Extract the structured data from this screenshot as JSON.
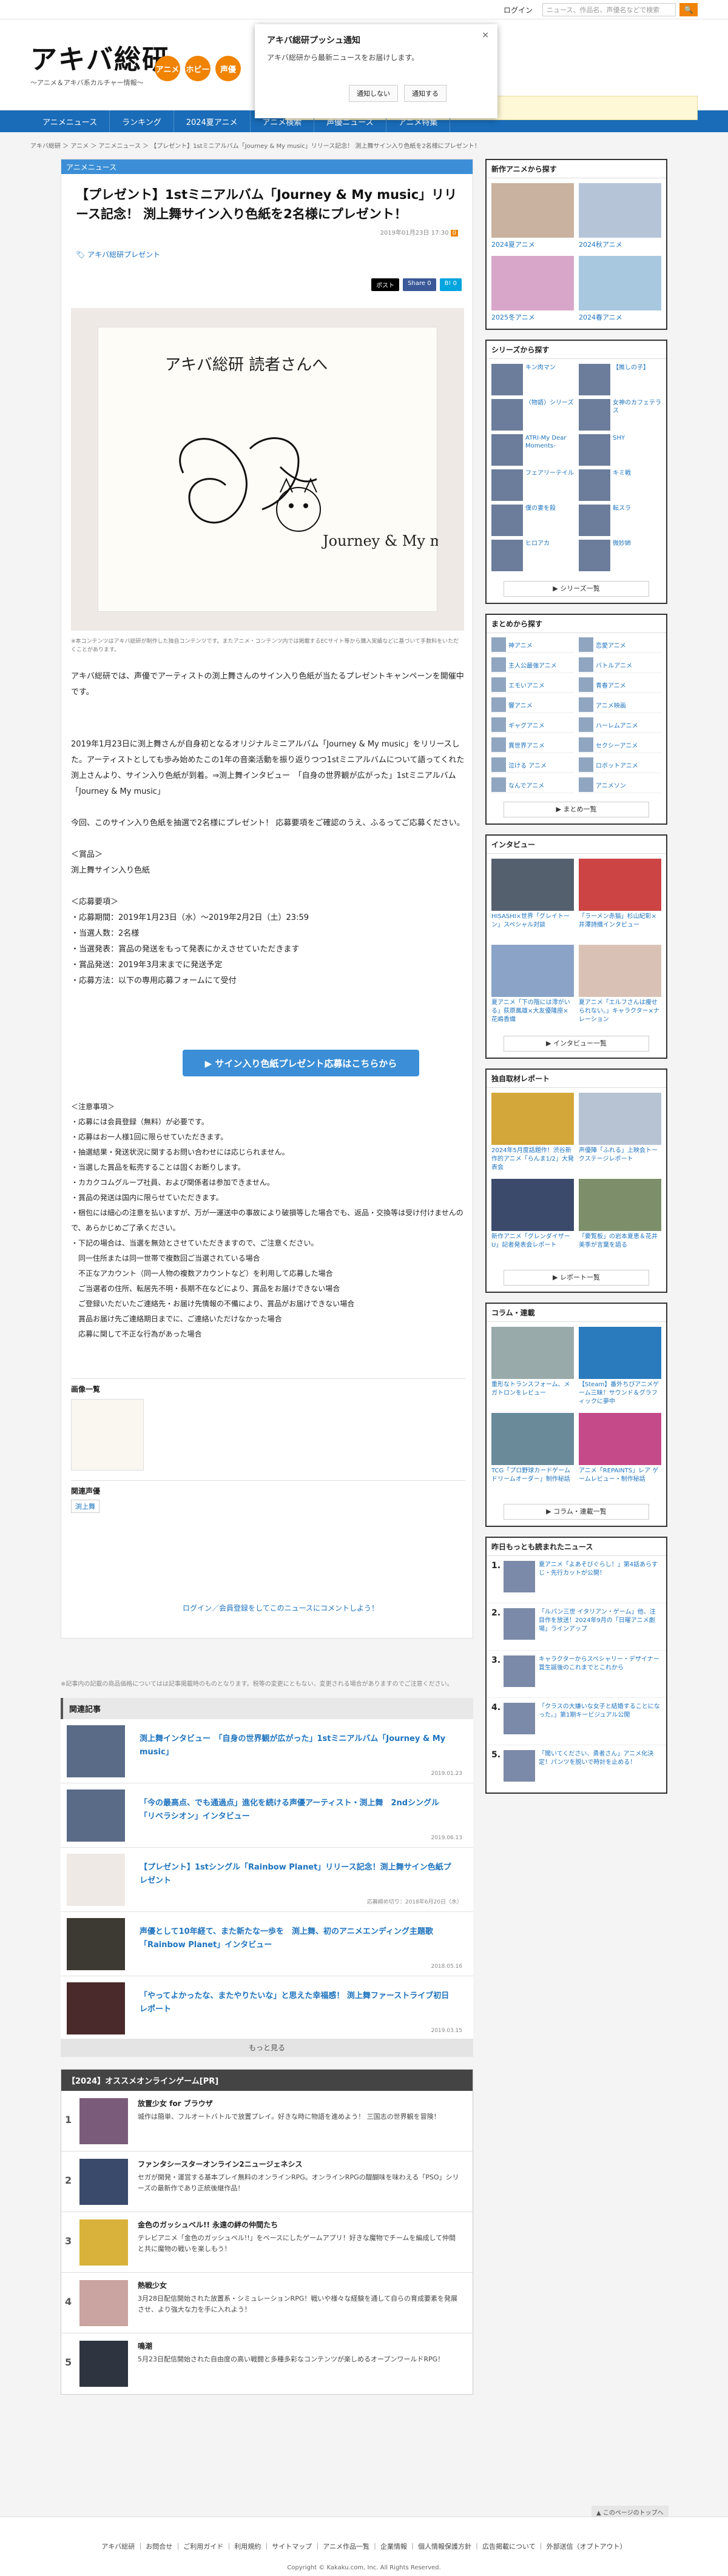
{
  "topbar": {
    "login": "ログイン",
    "search_placeholder": "ニュース、作品名、声優名などで検索",
    "search_btn": "🔍"
  },
  "header": {
    "logo": "アキバ総研",
    "logo_sub": "〜アニメ＆アキバ系カルチャー情報〜",
    "circles": [
      "アニメ",
      "ホビー",
      "声優"
    ]
  },
  "popup": {
    "title": "アキバ総研プッシュ通知",
    "message": "アキバ総研から最新ニュースをお届けします。",
    "deny": "通知しない",
    "allow": "通知する",
    "close": "×"
  },
  "nav": [
    "アニメニュース",
    "ランキング",
    "2024夏アニメ",
    "アニメ検索",
    "声優ニュース",
    "アニメ特集"
  ],
  "breadcrumb": "アキバ総研 ＞ アニメ ＞ アニメニュース ＞ 【プレゼント】1stミニアルバム「Journey & My music」リリース記念！ 渕上舞サイン入り色紙を2名様にプレゼント！",
  "article": {
    "band": "アニメニュース",
    "title": "【プレゼント】1stミニアルバム「Journey & My music」リリース記念！ 渕上舞サイン入り色紙を2名様にプレゼント！",
    "date": "2019年01月23日 17:30",
    "comments": "0",
    "tag": "アキバ総研プレゼント",
    "share": [
      "ポスト",
      "Share 0",
      "B! 0"
    ],
    "card_text": [
      "アキバ総研 読者さんへ",
      "Journey & My music"
    ],
    "caption": "※本コンテンツはアキバ総研が制作した独自コンテンツです。またアニメ・コンテンツ内では掲載するECサイト等から購入実績などに基づいて手数料をいただくことがあります。",
    "p1": "アキバ総研では、声優でアーティストの渕上舞さんのサイン入り色紙が当たるプレゼントキャンペーンを開催中です。",
    "p2": "2019年1月23日に渕上舞さんが自身初となるオリジナルミニアルバム「Journey & My music」をリリースした。アーティストとしても歩み始めたこの1年の音楽活動を振り返りつつ1stミニアルバムについて語ってくれた渕上さんより、サイン入り色紙が到着。⇒渕上舞インタビュー　「自身の世界観が広がった」1stミニアルバム「Journey & My music」",
    "p3": "今回、このサイン入り色紙を抽選で2名様にプレゼント！ 応募要項をご確認のうえ、ふるってご応募ください。",
    "prize_h": "＜賞品＞",
    "prize": "渕上舞サイン入り色紙",
    "req_h": "＜応募要項＞",
    "req": [
      "・応募期間：2019年1月23日（水）〜2019年2月2日（土）23:59",
      "・当選人数：2名様",
      "・当選発表：賞品の発送をもって発表にかえさせていただきます",
      "・賞品発送：2019年3月末までに発送予定",
      "・応募方法：以下の専用応募フォームにて受付"
    ],
    "cta": "▶ サイン入り色紙プレゼント応募はこちらから",
    "notes_h": "＜注意事項＞",
    "notes": [
      "・応募には会員登録（無料）が必要です。",
      "・応募はお一人様1回に限らせていただきます。",
      "・抽選結果・発送状況に関するお問い合わせには応じられません。",
      "・当選した賞品を転売することは固くお断りします。",
      "・カカクコムグループ社員、および関係者は参加できません。",
      "・賞品の発送は国内に限らせていただきます。",
      "・梱包には細心の注意を払いますが、万が一運送中の事故により破損等した場合でも、返品・交換等は受け付けませんので、あらかじめご了承ください。",
      "・下記の場合は、当選を無効とさせていただきますので、ご注意ください。",
      "　同一住所または同一世帯で複数回ご当選されている場合",
      "　不正なアカウント（同一人物の複数アカウントなど）を利用して応募した場合",
      "　ご当選者の住所、転居先不明・長期不在などにより、賞品をお届けできない場合",
      "　ご登録いただいたご連絡先・お届け先情報の不備により、賞品がお届けできない場合",
      "　賞品お届け先ご連絡期日までに、ご連絡いただけなかった場合",
      "　応募に関して不正な行為があった場合"
    ],
    "images_h": "画像一覧",
    "voice_h": "関連声優",
    "voice": "渕上舞",
    "comment_link": "ログイン／会員登録をしてこのニュースにコメントしよう！",
    "footnote": "※記事内の記載の商品価格についてはは記事掲載時のものとなります。税等の変更にともない、変更される場合がありますのでご注意ください。"
  },
  "related": {
    "title": "関連記事",
    "items": [
      {
        "title": "渕上舞インタビュー　「自身の世界観が広がった」1stミニアルバム「Journey & My music」",
        "date": "2019.01.23"
      },
      {
        "title": "「今の最高点、でも通過点」進化を続ける声優アーティスト・渕上舞　2ndシングル「リベラシオン」インタビュー",
        "date": "2019.06.13"
      },
      {
        "title": "【プレゼント】1stシングル「Rainbow Planet」リリース記念！渕上舞サイン色紙プレゼント",
        "date": "応募締め切り：2018年6月20日（水）"
      },
      {
        "title": "声優として10年経て、また新たな一歩を　渕上舞、初のアニメエンディング主題歌「Rainbow Planet」インタビュー",
        "date": "2018.05.16"
      },
      {
        "title": "「やってよかったな、またやりたいな」と思えた幸福感！ 渕上舞ファーストライブ初日レポート",
        "date": "2019.03.15"
      }
    ],
    "more": "もっと見る"
  },
  "game": {
    "title": "【2024】オススメオンラインゲーム[PR]",
    "items": [
      {
        "n": "1",
        "title": "放置少女 for ブラウザ",
        "desc": "城作は簡単、フルオートバトルで放置プレイ。好きな時に物語を進めよう！ 三国志の世界観を冒険！"
      },
      {
        "n": "2",
        "title": "ファンタシースターオンライン2ニュージェネシス",
        "desc": "セガが開発・運営する基本プレイ無料のオンラインRPG。オンラインRPGの醍醐味を味わえる「PSO」シリーズの最新作であり正統後継作品！"
      },
      {
        "n": "3",
        "title": "金色のガッシュベル!! 永遠の絆の仲間たち",
        "desc": "テレビアニメ「金色のガッシュベル!!」をベースにしたゲームアプリ！好きな魔物でチームを編成して仲間と共に魔物の戦いを楽しもう！"
      },
      {
        "n": "4",
        "title": "熱戦少女",
        "desc": "3月28日配信開始された放置系・シミュレーションRPG！戦いや様々な経験を通して自らの育成要素を発展させ、より強大な力を手に入れよう！"
      },
      {
        "n": "5",
        "title": "鳴潮",
        "desc": "5月23日配信開始された自由度の高い戦闘と多種多彩なコンテンツが楽しめるオープンワールドRPG！"
      }
    ]
  },
  "side": {
    "anime_h": "新作アニメから探す",
    "anime": [
      "2024夏アニメ",
      "2024秋アニメ",
      "2025冬アニメ",
      "2024春アニメ"
    ],
    "series_h": "シリーズから探す",
    "series": [
      "キン肉マン",
      "【推しの子】",
      "〈物語〉シリーズ",
      "女神のカフェテラス",
      "ATRI-My Dear Moments-",
      "SHY",
      "フェアリーテイル",
      "キミ戦",
      "僕の妻を殺",
      "転スラ",
      "ヒロアカ",
      "微妙姉"
    ],
    "series_btn": "▶ シリーズ一覧",
    "matome_h": "まとめから探す",
    "matome": [
      "神アニメ",
      "恋愛アニメ",
      "主人公最強アニメ",
      "バトルアニメ",
      "エモいアニメ",
      "青春アニメ",
      "響アニメ",
      "アニメ映画",
      "ギャグアニメ",
      "ハーレムアニメ",
      "異世界アニメ",
      "セクシーアニメ",
      "泣ける アニメ",
      "ロボットアニメ",
      "なんでアニメ",
      "アニメソン"
    ],
    "matome_btn": "▶ まとめ一覧",
    "iv_h": "インタビュー",
    "iv": [
      "HISASHI×世界「グレイトーン」スペシャル対談",
      "「ラーメン赤猫」杉山紀彰×井澤詩織インタビュー",
      "夏アニメ「下の階には澪がいる」荻原鳳雄×大友優隆座×花嶋香織",
      "夏アニメ「エルフさんは痩せられない。」キャラクター×ナレーション"
    ],
    "iv_btn": "▶ インタビュー一覧",
    "rep_h": "独自取材レポート",
    "rep": [
      "2024年5月度話題作！渋谷新作的アニメ「らんま1/2」大発表会",
      "声優陣「ふれる」上映会トークステージレポート",
      "新作アニメ「グレンダイザーU」記者発表会レポート",
      "「要覧板」の岩本夏恵＆花井美季が言葉を語る"
    ],
    "rep_btn": "▶ レポート一覧",
    "col_h": "コラム・連載",
    "col": [
      "重形なトランスフォーム、メガトロンをレビュー",
      "【Steam】番外ちびアニメゲーム三昧！サウンド＆グラフィックに夢中",
      "TCG「プロ野球カードゲーム ドリームオーダー」制作秘話",
      "アニメ「REPAINTS」レア ゲームレビュー・制作秘話"
    ],
    "col_btn": "▶ コラム・連載一覧",
    "rank_h": "昨日もっとも読まれたニュース",
    "rank": [
      "夏アニメ「よあそびぐらし！」第4話あらすじ・先行カットが公開！",
      "「ルパン三世 イタリアン・ゲーム」他、注目作を放送！2024年9月の「日曜アニメ劇場」ラインアップ",
      "キャラクターからスペシャリー・デザイナー賞生誕後のこれまでとこれから",
      "「クラスの大嫌いな女子と結婚することになった。」第1期キービジュアル公開",
      "「聞いてください、勇者さん」アニメ化決定！パンツを脱いで時計を止める！"
    ],
    "pagetop": "▲ このページのトップへ"
  },
  "footer": {
    "links": "アキバ総研 ｜ お問合せ ｜ ご利用ガイド ｜ 利用規約 ｜ サイトマップ ｜ アニメ作品一覧 ｜ 企業情報 ｜ 個人情報保護方針 ｜ 広告掲載について ｜ 外部送信（オプトアウト）",
    "copy": "Copyright © Kakaku.com, Inc. All Rights Reserved."
  }
}
